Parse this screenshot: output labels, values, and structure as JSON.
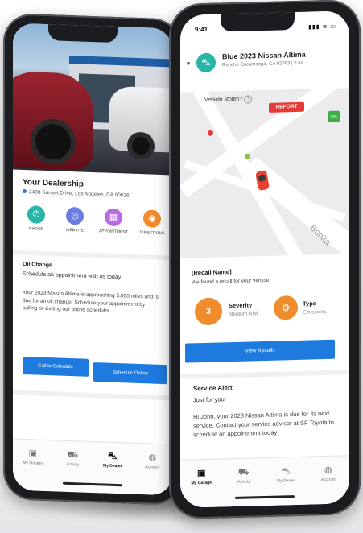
{
  "left_phone": {
    "dealer": {
      "title": "Your Dealership",
      "address": "2498 Sunset Drive, Los Angeles, CA 90026"
    },
    "actions": [
      {
        "label": "PHONE",
        "icon": "phone-icon",
        "color": "#26b5a6",
        "glyph": "✆"
      },
      {
        "label": "WEBSITE",
        "icon": "globe-icon",
        "color": "#6a7ce0",
        "glyph": "◎"
      },
      {
        "label": "APPOINTMENT",
        "icon": "calendar-icon",
        "color": "#b76be0",
        "glyph": "▦"
      },
      {
        "label": "DIRECTIONS",
        "icon": "location-icon",
        "color": "#f08c2e",
        "glyph": "◉"
      }
    ],
    "oil_change": {
      "title": "Oil Change",
      "subtitle": "Schedule an appointment with us today",
      "body": "Your 2023 Nissan Altima is approaching 5,000 miles and is due for an oil change. Schedule your appointment by calling or visiting our online scheduler.",
      "call_button": "Call to Schedule",
      "online_button": "Schedule Online"
    },
    "tabs": [
      {
        "label": "My Garage",
        "icon": "garage-icon",
        "glyph": "▣",
        "active": false
      },
      {
        "label": "Activity",
        "icon": "car-icon",
        "glyph": "⛟",
        "active": false
      },
      {
        "label": "My Dealer",
        "icon": "car-front-icon",
        "glyph": "⛍",
        "active": true
      },
      {
        "label": "Account",
        "icon": "user-icon",
        "glyph": "◍",
        "active": false
      }
    ]
  },
  "right_phone": {
    "status_time": "9:41",
    "vehicle": {
      "name": "Blue 2023 Nissan Altima",
      "location": "Rancho Cucamonga, CA 92763 | 5 mi"
    },
    "stolen_label": "Vehicle stolen?",
    "report_button": "REPORT",
    "battery_label": "95%",
    "map_street_label": "Bonita",
    "recall": {
      "name": "[Recall Name]",
      "subtitle": "We found a recall for your vehicle",
      "severity_number": "3",
      "severity_label": "Severity",
      "severity_value": "Medium Risk",
      "type_label": "Type",
      "type_value": "Emissions",
      "button": "View Recalls"
    },
    "service_alert": {
      "title": "Service Alert",
      "subtitle": "Just for you!",
      "body": "Hi John, your 2023 Nissan Altima is due for its next service. Contact your service advisor at SF Toyota to schedule an appointment today!"
    },
    "tabs": [
      {
        "label": "My Garage",
        "icon": "garage-icon",
        "glyph": "▣",
        "active": true
      },
      {
        "label": "Activity",
        "icon": "car-icon",
        "glyph": "⛟",
        "active": false
      },
      {
        "label": "My Dealer",
        "icon": "car-front-icon",
        "glyph": "⛍",
        "active": false
      },
      {
        "label": "Account",
        "icon": "user-icon",
        "glyph": "◍",
        "active": false
      }
    ]
  },
  "colors": {
    "primary_blue": "#1f7ae0",
    "accent_orange": "#f08c2e",
    "teal": "#26b5a6",
    "report_red": "#e53935"
  }
}
